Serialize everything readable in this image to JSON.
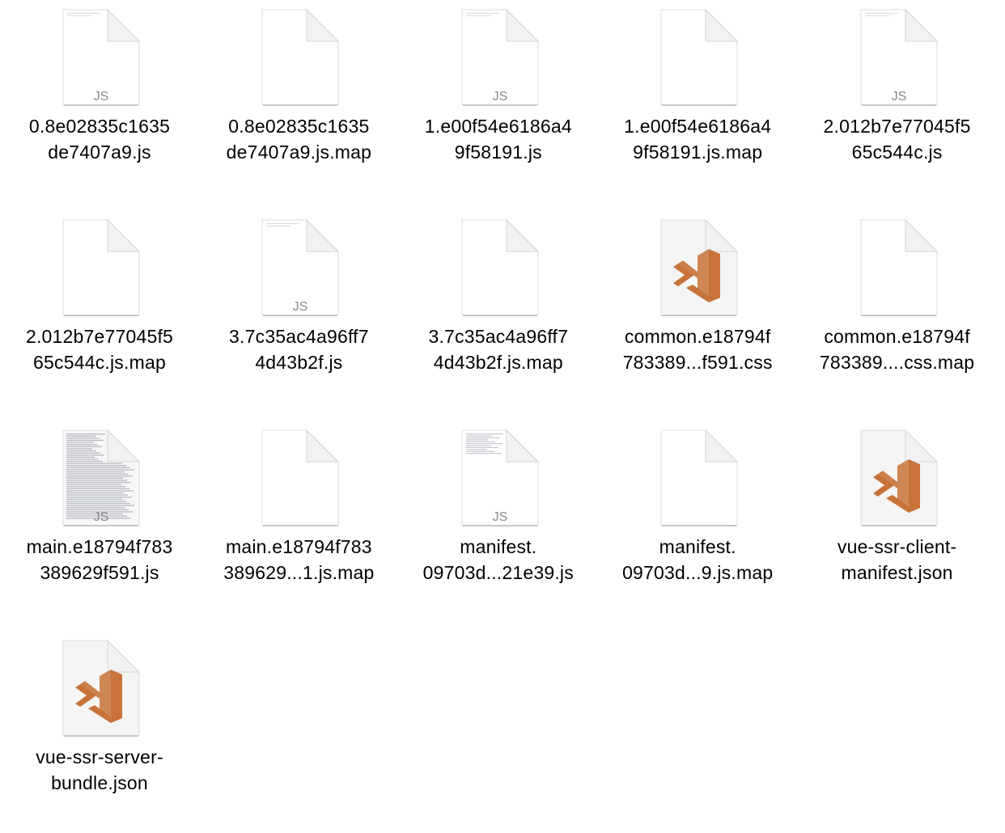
{
  "files": [
    {
      "name_line1": "0.8e02835c1635",
      "name_line2": "de7407a9.js",
      "icon": "js-document-icon",
      "kind": "js"
    },
    {
      "name_line1": "0.8e02835c1635",
      "name_line2": "de7407a9.js.map",
      "icon": "blank-document-icon",
      "kind": "blank"
    },
    {
      "name_line1": "1.e00f54e6186a4",
      "name_line2": "9f58191.js",
      "icon": "js-document-icon",
      "kind": "js"
    },
    {
      "name_line1": "1.e00f54e6186a4",
      "name_line2": "9f58191.js.map",
      "icon": "blank-document-icon",
      "kind": "blank"
    },
    {
      "name_line1": "2.012b7e77045f5",
      "name_line2": "65c544c.js",
      "icon": "js-document-icon",
      "kind": "js"
    },
    {
      "name_line1": "2.012b7e77045f5",
      "name_line2": "65c544c.js.map",
      "icon": "blank-document-icon",
      "kind": "blank"
    },
    {
      "name_line1": "3.7c35ac4a96ff7",
      "name_line2": "4d43b2f.js",
      "icon": "js-document-icon",
      "kind": "js"
    },
    {
      "name_line1": "3.7c35ac4a96ff7",
      "name_line2": "4d43b2f.js.map",
      "icon": "blank-document-icon",
      "kind": "blank"
    },
    {
      "name_line1": "common.e18794f",
      "name_line2": "783389...f591.css",
      "icon": "visual-studio-code-document-icon",
      "kind": "vscode"
    },
    {
      "name_line1": "common.e18794f",
      "name_line2": "783389....css.map",
      "icon": "blank-document-icon",
      "kind": "blank"
    },
    {
      "name_line1": "main.e18794f783",
      "name_line2": "389629f591.js",
      "icon": "js-document-dense-icon",
      "kind": "jsdense"
    },
    {
      "name_line1": "main.e18794f783",
      "name_line2": "389629...1.js.map",
      "icon": "blank-document-icon",
      "kind": "blank"
    },
    {
      "name_line1": "manifest.",
      "name_line2": "09703d...21e39.js",
      "icon": "js-document-icon",
      "kind": "jsmid"
    },
    {
      "name_line1": "manifest.",
      "name_line2": "09703d...9.js.map",
      "icon": "blank-document-icon",
      "kind": "blank"
    },
    {
      "name_line1": "vue-ssr-client-",
      "name_line2": "manifest.json",
      "icon": "visual-studio-code-document-icon",
      "kind": "vscode"
    },
    {
      "name_line1": "vue-ssr-server-",
      "name_line2": "bundle.json",
      "icon": "visual-studio-code-document-icon",
      "kind": "vscode"
    }
  ],
  "icon_badge_text": "JS",
  "colors": {
    "page_background": "#ffffff",
    "label_text": "#000000",
    "vscode_orange": "#c8733a",
    "badge_text": "#8a8a8a"
  }
}
